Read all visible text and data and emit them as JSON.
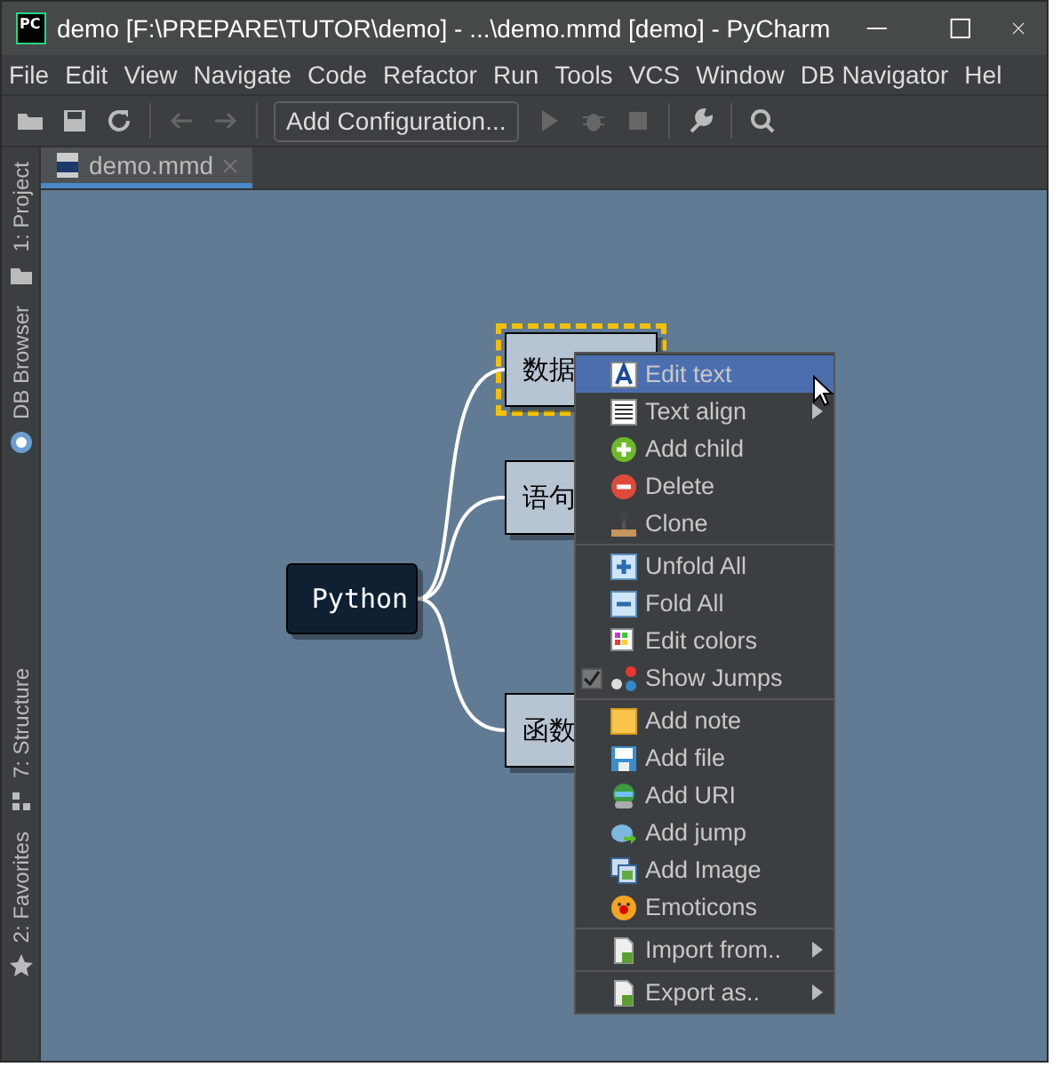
{
  "window": {
    "title": "demo [F:\\PREPARE\\TUTOR\\demo] - ...\\demo.mmd [demo] - PyCharm",
    "app_badge": "PC"
  },
  "menu_bar": [
    "File",
    "Edit",
    "View",
    "Navigate",
    "Code",
    "Refactor",
    "Run",
    "Tools",
    "VCS",
    "Window",
    "DB Navigator",
    "Hel"
  ],
  "toolbar": {
    "run_config": "Add Configuration..."
  },
  "tabs": [
    {
      "label": "demo.mmd",
      "selected": true
    }
  ],
  "side_strip": [
    "1: Project",
    "DB Browser",
    "7: Structure",
    "2: Favorites"
  ],
  "mind_map": {
    "root": "Python",
    "children": [
      {
        "label": "数据",
        "selected": true
      },
      {
        "label": "语句",
        "selected": false
      },
      {
        "label": "函数",
        "selected": false
      }
    ]
  },
  "context_menu": [
    [
      {
        "label": "Edit text",
        "selected": true,
        "submenu": false
      },
      {
        "label": "Text align",
        "selected": false,
        "submenu": true
      },
      {
        "label": "Add child",
        "selected": false,
        "submenu": false
      },
      {
        "label": "Delete",
        "selected": false,
        "submenu": false
      },
      {
        "label": "Clone",
        "selected": false,
        "submenu": false
      }
    ],
    [
      {
        "label": "Unfold All",
        "selected": false,
        "submenu": false
      },
      {
        "label": "Fold All",
        "selected": false,
        "submenu": false
      },
      {
        "label": "Edit colors",
        "selected": false,
        "submenu": false
      },
      {
        "label": "Show Jumps",
        "selected": false,
        "submenu": false,
        "kind": "check",
        "checked": true
      }
    ],
    [
      {
        "label": "Add note",
        "selected": false,
        "submenu": false
      },
      {
        "label": "Add file",
        "selected": false,
        "submenu": false
      },
      {
        "label": "Add URI",
        "selected": false,
        "submenu": false
      },
      {
        "label": "Add jump",
        "selected": false,
        "submenu": false
      },
      {
        "label": "Add Image",
        "selected": false,
        "submenu": false
      },
      {
        "label": "Emoticons",
        "selected": false,
        "submenu": false
      }
    ],
    [
      {
        "label": "Import from..",
        "selected": false,
        "submenu": true
      }
    ],
    [
      {
        "label": "Export as..",
        "selected": false,
        "submenu": true
      }
    ]
  ]
}
